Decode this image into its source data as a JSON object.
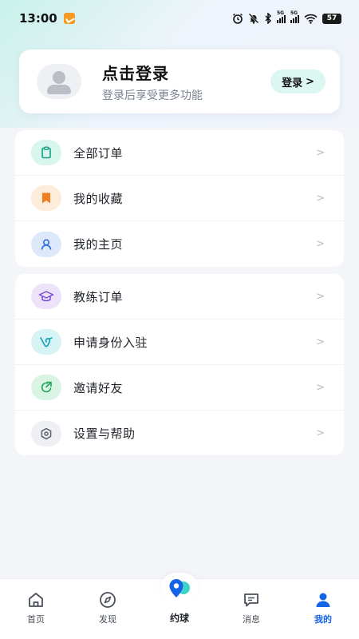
{
  "status_bar": {
    "time": "13:00",
    "network_label": "5G",
    "battery": "57"
  },
  "profile": {
    "title": "点击登录",
    "subtitle": "登录后享受更多功能",
    "login_label": "登录",
    "login_chevron": ">"
  },
  "menu_group_1": [
    {
      "label": "全部订单",
      "icon": "clipboard-icon",
      "icon_color": "#16a085",
      "bg": "#d8f5ee"
    },
    {
      "label": "我的收藏",
      "icon": "bookmark-icon",
      "icon_color": "#f07d20",
      "bg": "#fdecd9"
    },
    {
      "label": "我的主页",
      "icon": "user-icon",
      "icon_color": "#2e6bd6",
      "bg": "#dde9fb"
    }
  ],
  "menu_group_2": [
    {
      "label": "教练订单",
      "icon": "graduation-cap-icon",
      "icon_color": "#7b4bd6",
      "bg": "#ece3fb"
    },
    {
      "label": "申请身份入驻",
      "icon": "verify-v-icon",
      "icon_color": "#1aa3b8",
      "bg": "#d6f3f6"
    },
    {
      "label": "邀请好友",
      "icon": "share-arrow-icon",
      "icon_color": "#22a55a",
      "bg": "#daf4e3"
    },
    {
      "label": "设置与帮助",
      "icon": "settings-hex-icon",
      "icon_color": "#5a6270",
      "bg": "#eef0f4"
    }
  ],
  "menu_arrow": ">",
  "bottom_nav": [
    {
      "label": "首页",
      "icon": "home-icon"
    },
    {
      "label": "发现",
      "icon": "compass-icon"
    },
    {
      "label": "约球",
      "icon": "location-ball-icon"
    },
    {
      "label": "消息",
      "icon": "message-icon"
    },
    {
      "label": "我的",
      "icon": "profile-icon",
      "active": true
    }
  ],
  "colors": {
    "accent": "#1564e8",
    "login_button_bg": "#dcf6f1"
  }
}
